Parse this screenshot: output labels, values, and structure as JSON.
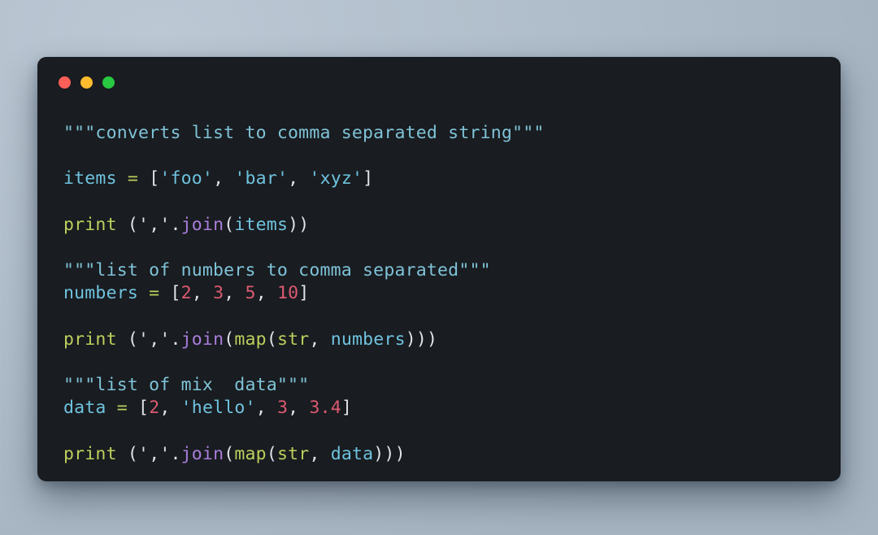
{
  "window": {
    "background_color": "#191c20",
    "page_background_color": "#aebccb",
    "traffic_lights": [
      {
        "name": "close",
        "label": "Close",
        "color": "#ff5f57"
      },
      {
        "name": "minimize",
        "label": "Minimize",
        "color": "#febc2e"
      },
      {
        "name": "maximize",
        "label": "Maximize",
        "color": "#28c840"
      }
    ]
  },
  "editor": {
    "language": "python",
    "theme_colors": {
      "docstring": "#7fc3d8",
      "variable": "#6fc3df",
      "string": "#6fc3df",
      "number": "#dc5a72",
      "builtin": "#bccf5d",
      "operator": "#bccf5d",
      "function": "#a97ddc",
      "punctuation": "#dfe4e9",
      "foreground": "#d6dbe0"
    },
    "lines": [
      {
        "n": 1,
        "text": "\"\"\"converts list to comma separated string\"\"\""
      },
      {
        "n": 2,
        "text": ""
      },
      {
        "n": 3,
        "text": "items = ['foo', 'bar', 'xyz']"
      },
      {
        "n": 4,
        "text": ""
      },
      {
        "n": 5,
        "text": "print (','.join(items))"
      },
      {
        "n": 6,
        "text": ""
      },
      {
        "n": 7,
        "text": "\"\"\"list of numbers to comma separated\"\"\""
      },
      {
        "n": 8,
        "text": "numbers = [2, 3, 5, 10]"
      },
      {
        "n": 9,
        "text": ""
      },
      {
        "n": 10,
        "text": "print (','.join(map(str, numbers)))"
      },
      {
        "n": 11,
        "text": ""
      },
      {
        "n": 12,
        "text": "\"\"\"list of mix  data\"\"\""
      },
      {
        "n": 13,
        "text": "data = [2, 'hello', 3, 3.4]"
      },
      {
        "n": 14,
        "text": ""
      },
      {
        "n": 15,
        "text": "print (','.join(map(str, data)))"
      }
    ],
    "tokens": {
      "doc_1": "\"\"\"converts list to comma separated string\"\"\"",
      "doc_2": "\"\"\"list of numbers to comma separated\"\"\"",
      "doc_3": "\"\"\"list of mix  data\"\"\"",
      "var_items": "items",
      "var_numbers": "numbers",
      "var_data": "data",
      "assign": "=",
      "builtin_print": "print",
      "builtin_map": "map",
      "builtin_str": "str",
      "method_join": "join",
      "str_foo": "'foo'",
      "str_bar": "'bar'",
      "str_xyz": "'xyz'",
      "str_hello": "'hello'",
      "str_comma": "','",
      "num_2": "2",
      "num_3": "3",
      "num_5": "5",
      "num_10": "10",
      "num_3b": "3",
      "num_34": "3.4",
      "open_bracket": "[",
      "close_bracket": "]",
      "open_paren": "(",
      "close_paren": ")",
      "comma_sep": ", ",
      "dot": ".",
      "space": " ",
      "paren_close_2": "))",
      "paren_close_3": ")))"
    }
  }
}
